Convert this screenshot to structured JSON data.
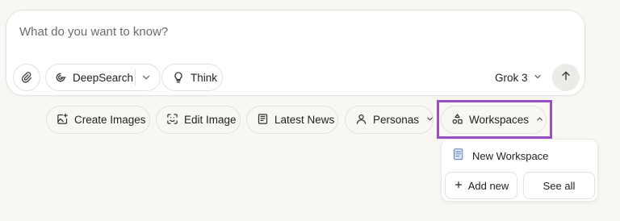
{
  "composer": {
    "placeholder": "What do you want to know?",
    "deepsearch_label": "DeepSearch",
    "think_label": "Think",
    "model_label": "Grok 3"
  },
  "chips": {
    "create_images": "Create Images",
    "edit_image": "Edit Image",
    "latest_news": "Latest News",
    "personas": "Personas",
    "workspaces": "Workspaces"
  },
  "workspaces_menu": {
    "new_workspace": "New Workspace",
    "add_new": "Add new",
    "see_all": "See all"
  },
  "colors": {
    "highlight": "#9a4fc8",
    "background": "#f8f7f4"
  }
}
